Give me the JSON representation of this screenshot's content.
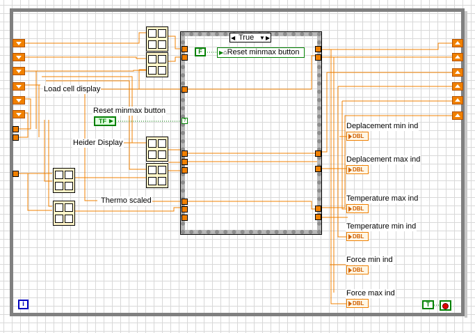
{
  "case_structure": {
    "selector_value": "True"
  },
  "local_variable": {
    "label": "Reset minmax button"
  },
  "false_constant": {
    "text": "F"
  },
  "true_constant": {
    "text": "T"
  },
  "iteration_terminal": {
    "text": "i"
  },
  "labels": {
    "load_cell_display": "Load cell display",
    "reset_minmax_button": "Reset minmax button",
    "heider_display": "Heider Display",
    "thermo_scaled": "Thermo scaled"
  },
  "boolean_control": {
    "text": "TF"
  },
  "indicators": [
    {
      "label": "Deplacement min ind",
      "type": "DBL"
    },
    {
      "label": "Deplacement max ind",
      "type": "DBL"
    },
    {
      "label": "Temperature max ind",
      "type": "DBL"
    },
    {
      "label": "Temperature min ind",
      "type": "DBL"
    },
    {
      "label": "Force min ind",
      "type": "DBL"
    },
    {
      "label": "Force max ind",
      "type": "DBL"
    }
  ],
  "colors": {
    "wire_numeric": "#f08000",
    "wire_boolean": "#008000",
    "loop_border": "#808080",
    "iteration_blue": "#0000c0",
    "stop_red": "#e00000"
  }
}
